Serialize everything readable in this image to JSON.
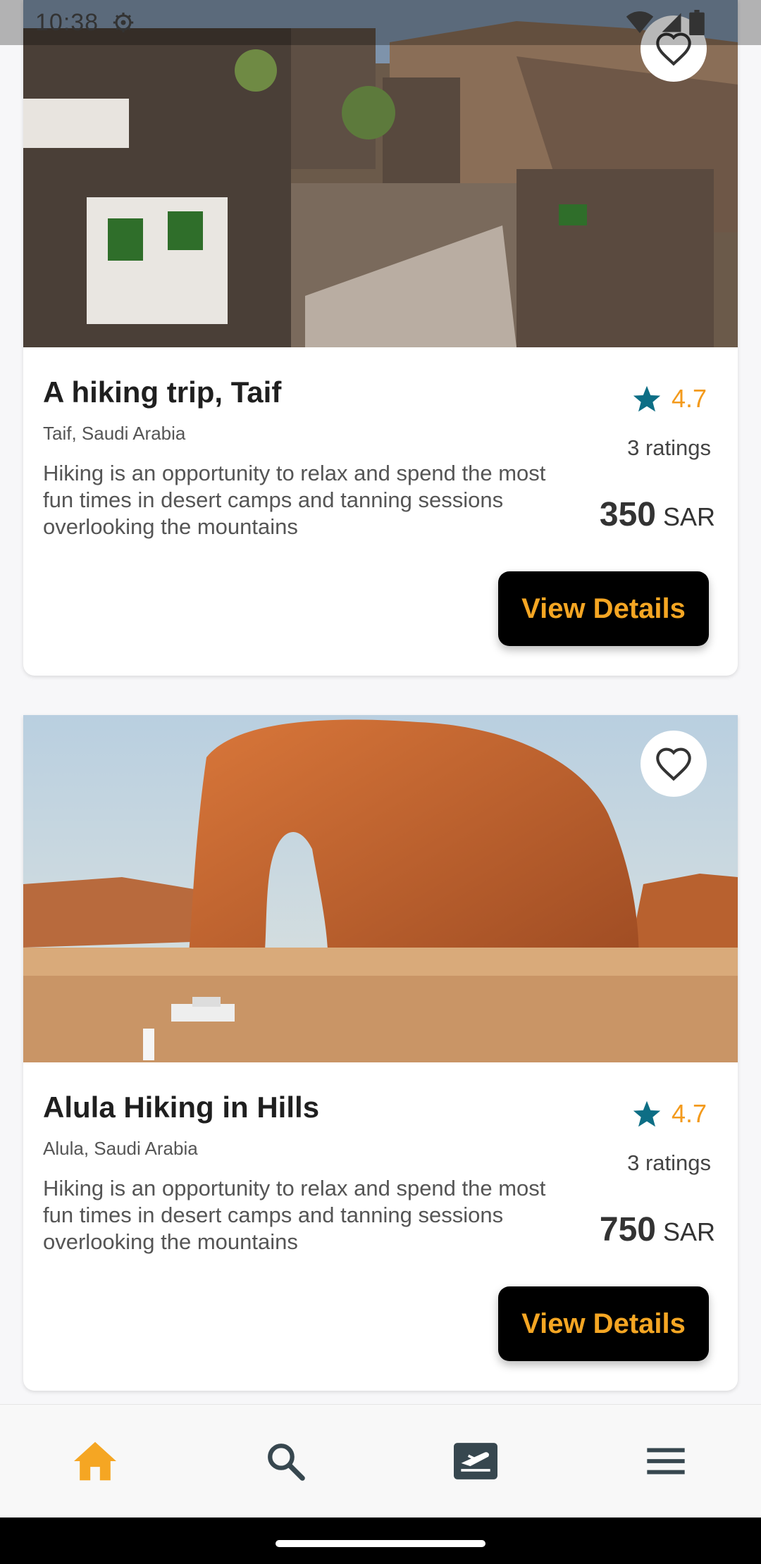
{
  "status_bar": {
    "time": "10:38",
    "icons": [
      "settings-icon",
      "wifi-icon",
      "signal-icon",
      "battery-icon"
    ]
  },
  "trips": [
    {
      "title": "A hiking trip, Taif",
      "location": "Taif, Saudi Arabia",
      "description": "Hiking is an opportunity to relax and spend the most fun times in desert camps and tanning sessions overlooking the mountains",
      "rating": "4.7",
      "ratings_count": "3 ratings",
      "price": "350",
      "currency": "SAR",
      "button_label": "View Details",
      "favorite": false
    },
    {
      "title": "Alula Hiking in Hills",
      "location": "Alula, Saudi Arabia",
      "description": "Hiking is an opportunity to relax and spend the most fun times in desert camps and tanning sessions overlooking the mountains",
      "rating": "4.7",
      "ratings_count": "3 ratings",
      "price": "750",
      "currency": "SAR",
      "button_label": "View Details",
      "favorite": false
    }
  ],
  "bottom_nav": {
    "items": [
      {
        "icon": "home-icon",
        "active": true
      },
      {
        "icon": "search-icon",
        "active": false
      },
      {
        "icon": "ticket-icon",
        "active": false
      },
      {
        "icon": "menu-icon",
        "active": false
      }
    ]
  },
  "colors": {
    "accent": "#f5a623",
    "star": "#0d6e85",
    "nav_icon": "#37474f",
    "button_bg": "#000000"
  }
}
